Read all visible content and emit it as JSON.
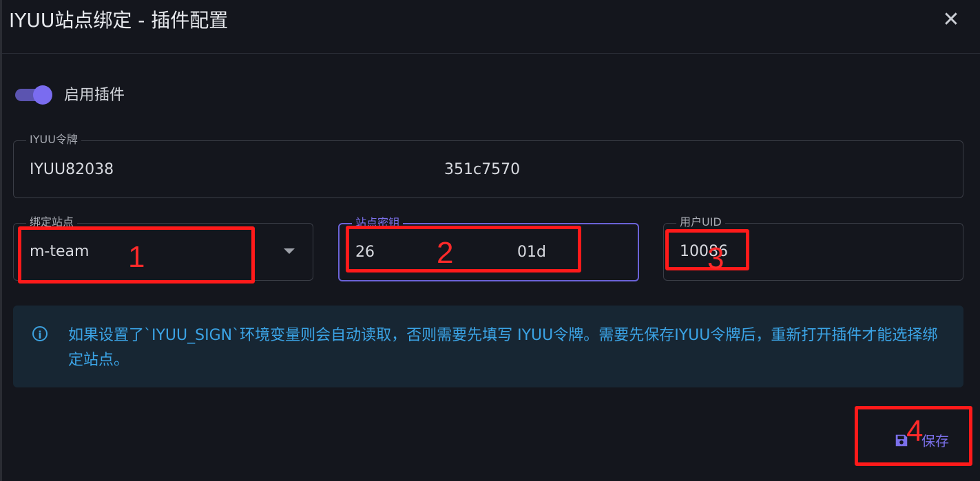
{
  "dialog": {
    "title": "IYUU站点绑定 - 插件配置",
    "close_icon": "close-icon"
  },
  "enable": {
    "label": "启用插件",
    "on": true
  },
  "token_field": {
    "label": "IYUU令牌",
    "value_start": "IYUU82038",
    "value_end": "351c7570"
  },
  "site_select": {
    "label": "绑定站点",
    "value": "m-team"
  },
  "site_key": {
    "label": "站点密钥",
    "value_start": "26",
    "value_end": "01d"
  },
  "uid_field": {
    "label": "用户UID",
    "value": "10086"
  },
  "alert": {
    "icon": "info-icon",
    "message": "如果设置了`IYUU_SIGN`环境变量则会自动读取，否则需要先填写 IYUU令牌。需要先保存IYUU令牌后，重新打开插件才能选择绑定站点。"
  },
  "save_button": {
    "label": "保存",
    "icon": "save-icon"
  },
  "annotations": [
    "1",
    "2",
    "3",
    "4"
  ],
  "colors": {
    "accent": "#7b70ea",
    "info": "#3ba4e6",
    "annotation": "#ff1a1a"
  }
}
